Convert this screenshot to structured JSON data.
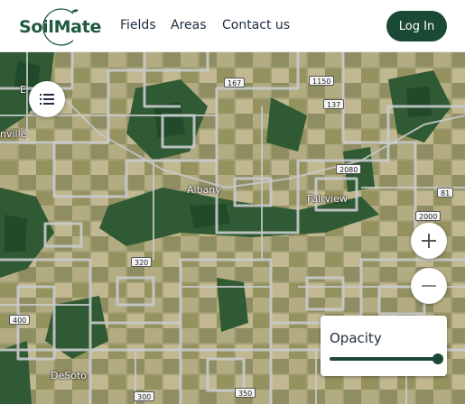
{
  "brand": {
    "name": "SoilMate",
    "color": "#1e5a3c"
  },
  "nav": {
    "items": [
      {
        "label": "Fields"
      },
      {
        "label": "Areas"
      },
      {
        "label": "Contact us"
      }
    ]
  },
  "auth": {
    "login_label": "Log In",
    "button_color": "#1a4a35"
  },
  "map": {
    "place_labels": [
      {
        "text": "Albany"
      },
      {
        "text": "Fairview"
      },
      {
        "text": "nville"
      },
      {
        "text": "DeSoto"
      },
      {
        "text": "E"
      }
    ],
    "road_shields": [
      {
        "text": "167"
      },
      {
        "text": "1150"
      },
      {
        "text": "137"
      },
      {
        "text": "2080"
      },
      {
        "text": "81"
      },
      {
        "text": "2000"
      },
      {
        "text": "320"
      },
      {
        "text": "400"
      },
      {
        "text": "300"
      },
      {
        "text": "350"
      }
    ],
    "layers_icon": "list-icon",
    "zoom_in_icon": "plus-icon",
    "zoom_out_icon": "minus-icon"
  },
  "opacity": {
    "label": "Opacity",
    "value": 1.0
  }
}
